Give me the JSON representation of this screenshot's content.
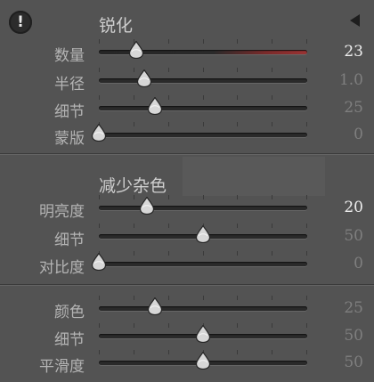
{
  "header": {
    "title": "锐化",
    "alert_icon": "exclamation-icon",
    "collapse_icon": "triangle-left-icon"
  },
  "sharpening": {
    "sliders": [
      {
        "label": "数量",
        "value": "23",
        "level": 0.18,
        "bright": true,
        "red": true
      },
      {
        "label": "半径",
        "value": "1.0",
        "level": 0.22,
        "bright": false,
        "red": false
      },
      {
        "label": "细节",
        "value": "25",
        "level": 0.27,
        "bright": false,
        "red": false
      },
      {
        "label": "蒙版",
        "value": "0",
        "level": 0.0,
        "bright": false,
        "red": false
      }
    ]
  },
  "noise": {
    "title": "减少杂色",
    "luminance": [
      {
        "label": "明亮度",
        "value": "20",
        "level": 0.23,
        "bright": true,
        "red": false
      },
      {
        "label": "细节",
        "value": "50",
        "level": 0.5,
        "bright": false,
        "red": false
      },
      {
        "label": "对比度",
        "value": "0",
        "level": 0.0,
        "bright": false,
        "red": false
      }
    ],
    "color": [
      {
        "label": "颜色",
        "value": "25",
        "level": 0.27,
        "bright": false,
        "red": false
      },
      {
        "label": "细节",
        "value": "50",
        "level": 0.5,
        "bright": false,
        "red": false
      },
      {
        "label": "平滑度",
        "value": "50",
        "level": 0.5,
        "bright": false,
        "red": false
      }
    ]
  }
}
